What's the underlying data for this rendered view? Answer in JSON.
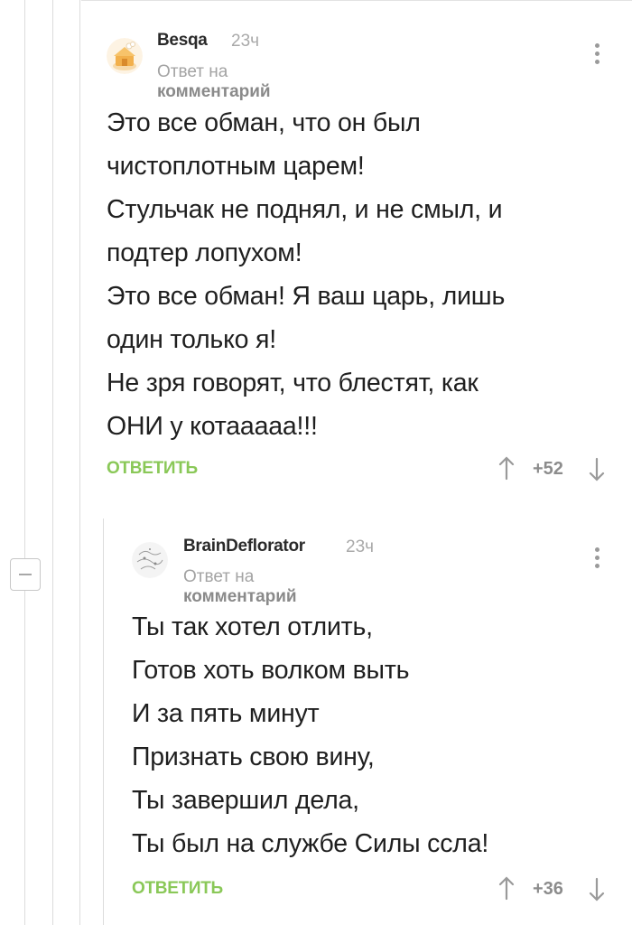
{
  "comments": [
    {
      "author": "Besqa",
      "time": "23ч",
      "reply_prefix": "Ответ на",
      "reply_target": "комментарий",
      "lines": [
        "Это все обман, что он был",
        "чистоплотным царем!",
        "Стульчак не поднял, и не смыл, и",
        "подтер  лопухом!",
        "Это все обман! Я ваш царь, лишь",
        "один только я!",
        "Не зря говорят, что блестят, как",
        "ОНИ у котааааа!!!"
      ],
      "reply_label": "ОТВЕТИТЬ",
      "score": "+52",
      "avatar_icon": "cake-house-avatar"
    },
    {
      "author": "BrainDeflorator",
      "time": "23ч",
      "reply_prefix": "Ответ на",
      "reply_target": "комментарий",
      "lines": [
        "Ты так хотел отлить,",
        "Готов хоть волком выть",
        "И за пять минут",
        "Признать свою вину,",
        "Ты завершил дела,",
        "Ты был на службе Силы ссла!"
      ],
      "reply_label": "ОТВЕТИТЬ",
      "score": "+36",
      "avatar_icon": "sketch-avatar"
    }
  ],
  "colors": {
    "accent_green": "#8ac858",
    "meta_gray": "#a3a3a3",
    "thread_line": "#dcdcdc"
  },
  "icons": [
    "more-vertical-icon",
    "arrow-up-icon",
    "arrow-down-icon",
    "collapse-minus-icon"
  ]
}
